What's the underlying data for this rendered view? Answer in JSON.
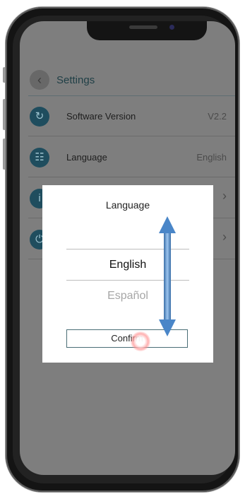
{
  "header": {
    "back_icon": "chevron-left-icon",
    "title": "Settings"
  },
  "settings_rows": [
    {
      "icon": "refresh-icon",
      "label": "Software Version",
      "value": "V2.2"
    },
    {
      "icon": "globe-icon",
      "label": "Language",
      "value": "English"
    },
    {
      "icon": "info-icon",
      "label": "",
      "value": ""
    },
    {
      "icon": "power-icon",
      "label": "",
      "value": ""
    }
  ],
  "dialog": {
    "title": "Language",
    "options": [
      "English",
      "Español"
    ],
    "selected": "English",
    "confirm_label": "Confirm"
  },
  "gesture": {
    "type": "vertical-scroll",
    "arrow_color": "#4a86c8",
    "tap_color": "#ff6b6b"
  }
}
